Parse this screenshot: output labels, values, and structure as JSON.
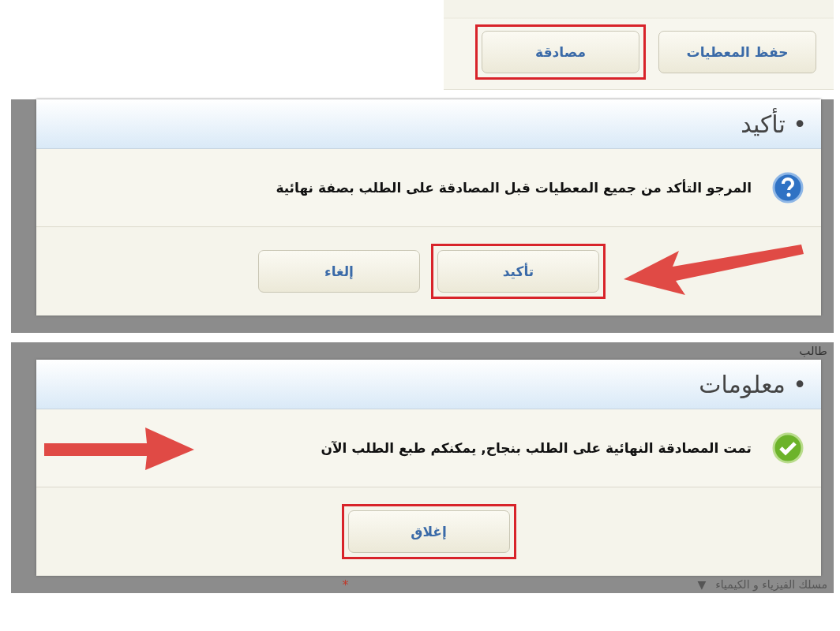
{
  "toolbar": {
    "buttons": [
      {
        "label": "حفظ المعطيات",
        "highlighted": false
      },
      {
        "label": "مصادقة",
        "highlighted": true
      }
    ]
  },
  "dialogs": [
    {
      "kind": "question",
      "title": "• تأكيد",
      "message": "المرجو التأكد من جميع المعطيات قبل المصادقة على الطلب بصفة نهائية",
      "footer_arrow": true,
      "message_arrow": false,
      "buttons": [
        {
          "label": "تأكيد",
          "highlighted": true
        },
        {
          "label": "إلغاء",
          "highlighted": false
        }
      ]
    },
    {
      "kind": "success",
      "title": "• معلومات",
      "message": "تمت المصادقة النهائية على الطلب بنجاح, يمكنكم طبع الطلب الآن",
      "footer_arrow": false,
      "message_arrow": true,
      "buttons": [
        {
          "label": "إغلاق",
          "highlighted": true
        }
      ],
      "background": {
        "label": "طالب",
        "field_value": "مسلك الفيزياء و الكيمياء",
        "caret": "▼",
        "required_mark": "*"
      }
    }
  ]
}
